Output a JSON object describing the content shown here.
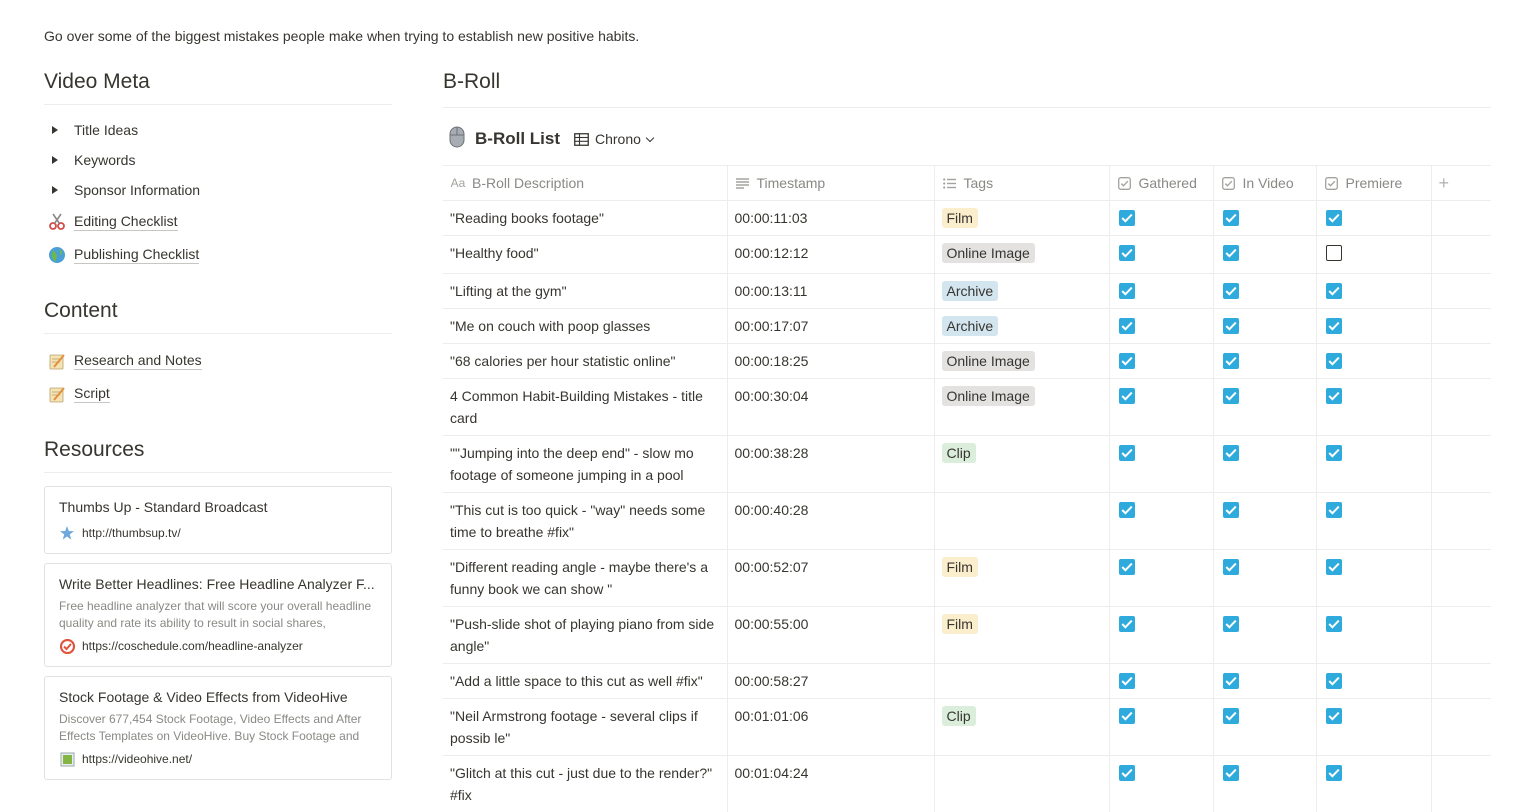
{
  "intro": "Go over some of the biggest mistakes people make when trying to establish new positive habits.",
  "left": {
    "video_meta": {
      "title": "Video Meta",
      "toggles": [
        "Title Ideas",
        "Keywords",
        "Sponsor Information"
      ],
      "pages": [
        {
          "label": "Editing Checklist",
          "icon": "scissors-icon"
        },
        {
          "label": "Publishing Checklist",
          "icon": "globe-icon"
        }
      ]
    },
    "content": {
      "title": "Content",
      "pages": [
        {
          "label": "Research and Notes",
          "icon": "memo-icon"
        },
        {
          "label": "Script",
          "icon": "memo-icon"
        }
      ]
    },
    "resources": {
      "title": "Resources",
      "bookmarks": [
        {
          "title": "Thumbs Up - Standard Broadcast",
          "desc": "",
          "url": "http://thumbsup.tv/",
          "icon": "star-favicon"
        },
        {
          "title": "Write Better Headlines: Free Headline Analyzer F...",
          "desc": "Free headline analyzer that will score your overall headline quality and rate its ability to result in social shares,",
          "url": "https://coschedule.com/headline-analyzer",
          "icon": "coschedule-favicon"
        },
        {
          "title": "Stock Footage & Video Effects from VideoHive",
          "desc": "Discover 677,454 Stock Footage, Video Effects and After Effects Templates on VideoHive. Buy Stock Footage and",
          "url": "https://videohive.net/",
          "icon": "videohive-favicon"
        }
      ]
    }
  },
  "right": {
    "title": "B-Roll",
    "db_title": "B-Roll List",
    "db_icon": "computer-mouse-icon",
    "view_name": "Chrono",
    "columns": {
      "desc": "B-Roll Description",
      "timestamp": "Timestamp",
      "tags": "Tags",
      "gathered": "Gathered",
      "in_video": "In Video",
      "premiere": "Premiere",
      "add": "+"
    },
    "tag_colors": {
      "Film": "#fbeecc",
      "Online Image": "#e3e2e0",
      "Archive": "#d3e5ef",
      "Clip": "#dbeddb"
    },
    "check_color": "#2eaadc",
    "rows": [
      {
        "desc": "\"Reading books footage\"",
        "timestamp": "00:00:11:03",
        "tag": "Film",
        "gathered": true,
        "in_video": true,
        "premiere": true
      },
      {
        "desc": "\"Healthy food\"",
        "timestamp": "00:00:12:12",
        "tag": "Online Image",
        "gathered": true,
        "in_video": true,
        "premiere": false
      },
      {
        "desc": "\"Lifting at the gym\"",
        "timestamp": "00:00:13:11",
        "tag": "Archive",
        "gathered": true,
        "in_video": true,
        "premiere": true
      },
      {
        "desc": "\"Me on couch with poop glasses",
        "timestamp": "00:00:17:07",
        "tag": "Archive",
        "gathered": true,
        "in_video": true,
        "premiere": true
      },
      {
        "desc": "\"68 calories per hour statistic online\"",
        "timestamp": "00:00:18:25",
        "tag": "Online Image",
        "gathered": true,
        "in_video": true,
        "premiere": true
      },
      {
        "desc": "4 Common Habit-Building Mistakes - title card",
        "timestamp": "00:00:30:04",
        "tag": "Online Image",
        "gathered": true,
        "in_video": true,
        "premiere": true
      },
      {
        "desc": "\"\"Jumping into the deep end\" - slow mo footage of someone jumping in a pool",
        "timestamp": "00:00:38:28",
        "tag": "Clip",
        "gathered": true,
        "in_video": true,
        "premiere": true
      },
      {
        "desc": "\"This cut is too quick - \"way\" needs some time to breathe #fix\"",
        "timestamp": "00:00:40:28",
        "tag": "",
        "gathered": true,
        "in_video": true,
        "premiere": true
      },
      {
        "desc": "\"Different reading angle - maybe there's a funny book we can show \"",
        "timestamp": "00:00:52:07",
        "tag": "Film",
        "gathered": true,
        "in_video": true,
        "premiere": true
      },
      {
        "desc": "\"Push-slide shot of playing piano from side angle\"",
        "timestamp": "00:00:55:00",
        "tag": "Film",
        "gathered": true,
        "in_video": true,
        "premiere": true
      },
      {
        "desc": "\"Add a little space to this cut as well #fix\"",
        "timestamp": "00:00:58:27",
        "tag": "",
        "gathered": true,
        "in_video": true,
        "premiere": true
      },
      {
        "desc": "\"Neil Armstrong footage - several clips if possib le\"",
        "timestamp": "00:01:01:06",
        "tag": "Clip",
        "gathered": true,
        "in_video": true,
        "premiere": true
      },
      {
        "desc": "\"Glitch at this cut - just due to the render?\" #fix",
        "timestamp": "00:01:04:24",
        "tag": "",
        "gathered": true,
        "in_video": true,
        "premiere": true
      }
    ]
  }
}
